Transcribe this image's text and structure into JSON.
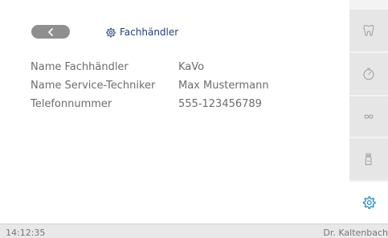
{
  "header": {
    "back_icon": "chevron-left-icon",
    "title_icon": "gear-icon",
    "title": "Fachhändler"
  },
  "details": [
    {
      "label": "Name Fachhändler",
      "value": "KaVo"
    },
    {
      "label": "Name Service-Techniker",
      "value": "Max Mustermann"
    },
    {
      "label": "Telefonnummer",
      "value": "555-123456789"
    }
  ],
  "sidebar": {
    "items": [
      {
        "icon": "tooth-icon"
      },
      {
        "icon": "timer-icon"
      },
      {
        "icon": "infinity-icon"
      },
      {
        "icon": "spray-bottle-icon"
      },
      {
        "icon": "gear-icon",
        "active": true
      }
    ]
  },
  "status": {
    "time": "14:12:35",
    "user": "Dr. Kaltenbach"
  },
  "colors": {
    "accent": "#1c3f87",
    "active_icon": "#1f8fd0",
    "button": "#8f8f8f",
    "text": "#6d6d6d"
  }
}
